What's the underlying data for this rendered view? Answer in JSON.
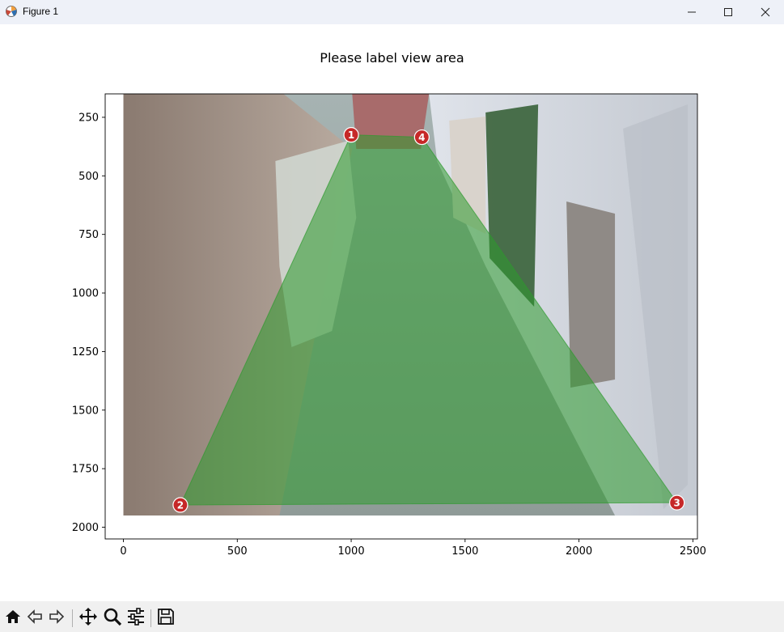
{
  "window": {
    "title": "Figure 1",
    "minimize_icon": "minimize-icon",
    "maximize_icon": "maximize-icon",
    "close_icon": "close-icon"
  },
  "toolbar": {
    "icons": [
      "home-icon",
      "back-arrow-icon",
      "forward-arrow-icon",
      "pan-icon",
      "zoom-icon",
      "configure-subplots-icon",
      "save-icon"
    ]
  },
  "chart_data": {
    "type": "scatter",
    "title": "Please label view area",
    "xlabel": "",
    "ylabel": "",
    "xlim": [
      -80,
      2520
    ],
    "ylim": [
      2050,
      150
    ],
    "y_inverted": true,
    "xticks": [
      0,
      500,
      1000,
      1500,
      2000,
      2500
    ],
    "xtick_labels": [
      "0",
      "500",
      "1000",
      "1500",
      "2000",
      "2500"
    ],
    "yticks": [
      250,
      500,
      750,
      1000,
      1250,
      1500,
      1750,
      2000
    ],
    "ytick_labels": [
      "250",
      "500",
      "750",
      "1000",
      "1250",
      "1500",
      "1750",
      "2000"
    ],
    "background_image": "corridor-camera-photo",
    "image_extent": {
      "x": [
        0,
        2520
      ],
      "y": [
        1950,
        150
      ]
    },
    "polygon_color": "#2e9a2e",
    "point_color": "#c62828",
    "points": [
      {
        "label": "1",
        "x": 1000,
        "y": 325
      },
      {
        "label": "2",
        "x": 250,
        "y": 1905
      },
      {
        "label": "3",
        "x": 2430,
        "y": 1895
      },
      {
        "label": "4",
        "x": 1310,
        "y": 335
      }
    ],
    "grid": false
  }
}
